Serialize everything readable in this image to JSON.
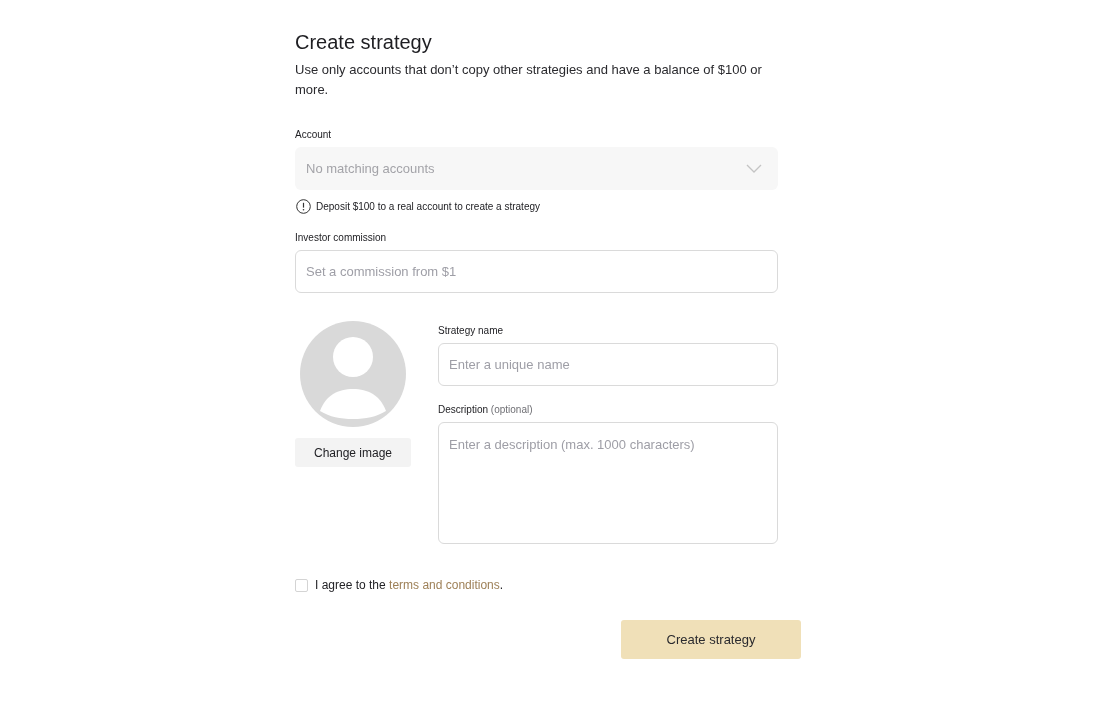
{
  "header": {
    "title": "Create strategy",
    "subtitle": "Use only accounts that don’t copy other strategies and have a balance of $100 or more."
  },
  "account": {
    "label": "Account",
    "placeholder": "No matching accounts",
    "disabled": true,
    "hint": "Deposit $100 to a real account to create a strategy"
  },
  "commission": {
    "label": "Investor commission",
    "placeholder": "Set a commission from $1"
  },
  "image": {
    "button": "Change image"
  },
  "strategy_name": {
    "label": "Strategy name",
    "placeholder": "Enter a unique name"
  },
  "description": {
    "label": "Description",
    "note": "(optional)",
    "placeholder": "Enter a description (max. 1000 characters)"
  },
  "agreement": {
    "checked": false,
    "text_before": "I agree to the ",
    "link": "terms and conditions",
    "text_after": "."
  },
  "submit": {
    "label": "Create strategy",
    "disabled": true
  }
}
